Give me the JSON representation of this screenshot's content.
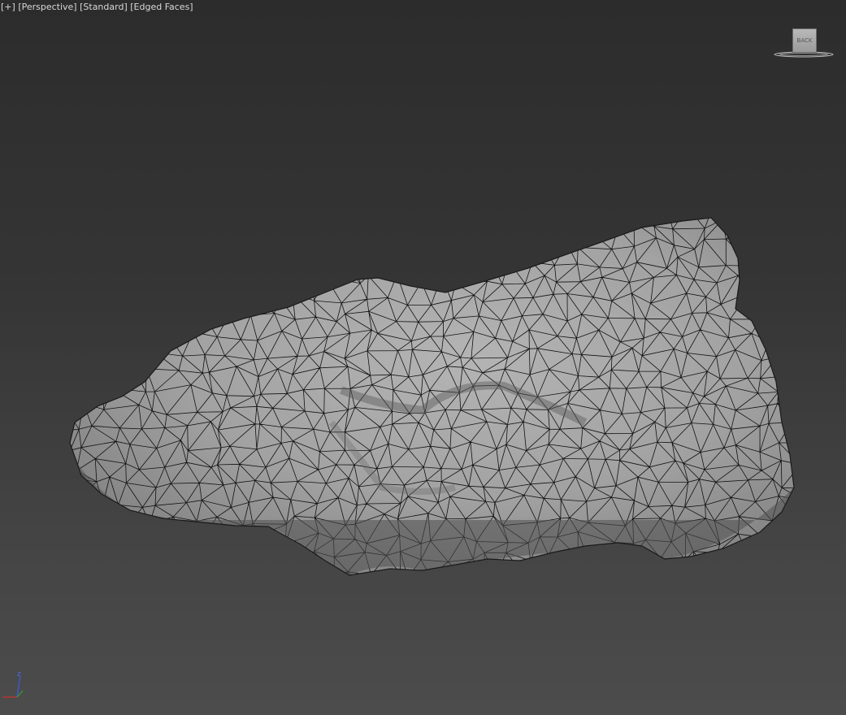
{
  "viewport": {
    "label_parts": [
      "[+]",
      "[Perspective]",
      "[Standard]",
      "[Edged Faces]"
    ]
  },
  "viewcube": {
    "face_label": "BACK"
  },
  "axis_gizmo": {
    "z_label": "z"
  },
  "colors": {
    "background_top": "#2c2c2c",
    "background_bottom": "#4c4c4c",
    "mesh_fill": "#a9a9a9",
    "mesh_edges": "#111111",
    "axis_x": "#c83232",
    "axis_y": "#32a032",
    "axis_z": "#3c5adc"
  },
  "icons": [
    "viewcube-icon",
    "axis-gizmo-icon"
  ]
}
